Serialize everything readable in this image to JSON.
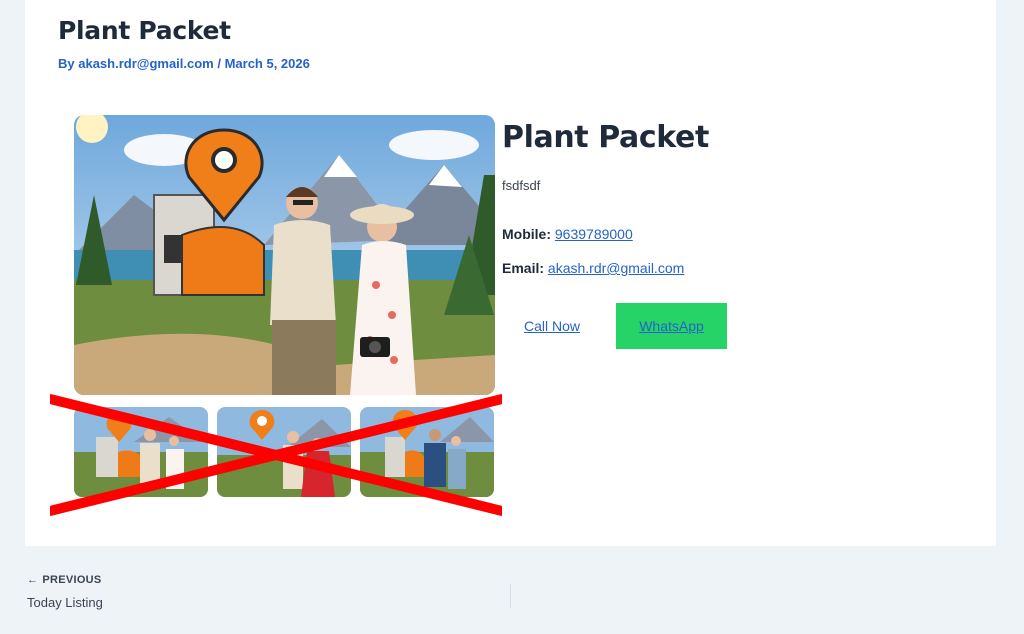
{
  "post": {
    "title": "Plant Packet",
    "meta_by": "By akash.rdr@gmail.com",
    "meta_sep": " / ",
    "meta_date": "March 5, 2026"
  },
  "listing": {
    "title": "Plant Packet",
    "description": "fsdfsdf",
    "mobile_label": "Mobile:",
    "mobile_value": "9639789000",
    "email_label": "Email:",
    "email_value": "akash.rdr@gmail.com",
    "call_button": "Call Now",
    "whatsapp_button": "WhatsApp"
  },
  "navigation": {
    "prev_label": "PREVIOUS",
    "prev_title": "Today Listing"
  },
  "colors": {
    "accent": "#2563c9",
    "whatsapp": "#25d366",
    "cross": "#ff0000",
    "background": "#eef3f8"
  }
}
